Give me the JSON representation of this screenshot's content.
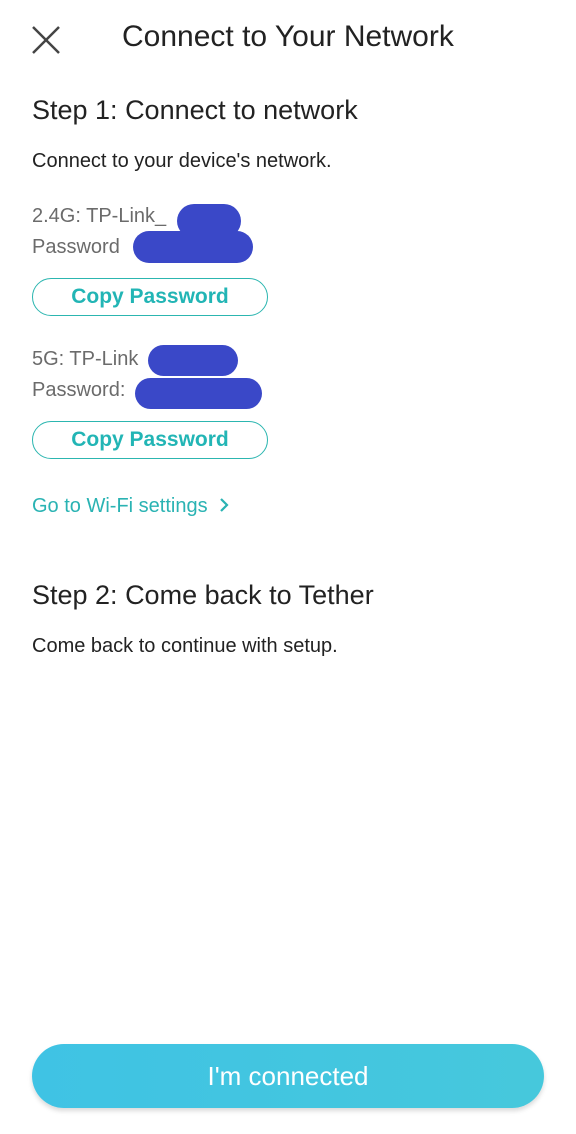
{
  "header": {
    "close_icon": "close-icon",
    "title": "Connect to Your Network"
  },
  "step1": {
    "heading": "Step 1: Connect to network",
    "description": "Connect to your device's network.",
    "networks": [
      {
        "ssid_label": "2.4G: TP-Link_",
        "password_label": "Password",
        "copy_label": "Copy Password"
      },
      {
        "ssid_label": "5G: TP-Link",
        "password_label": "Password:",
        "copy_label": "Copy Password"
      }
    ],
    "wifi_link": "Go to Wi-Fi settings",
    "wifi_link_icon": "chevron-right-icon"
  },
  "step2": {
    "heading": "Step 2: Come back to Tether",
    "description": "Come back to continue with setup."
  },
  "footer": {
    "connected_label": "I'm connected"
  },
  "colors": {
    "accent": "#2ab3b3",
    "primary_button": "#42c5e0",
    "redaction": "#3a48c8"
  }
}
